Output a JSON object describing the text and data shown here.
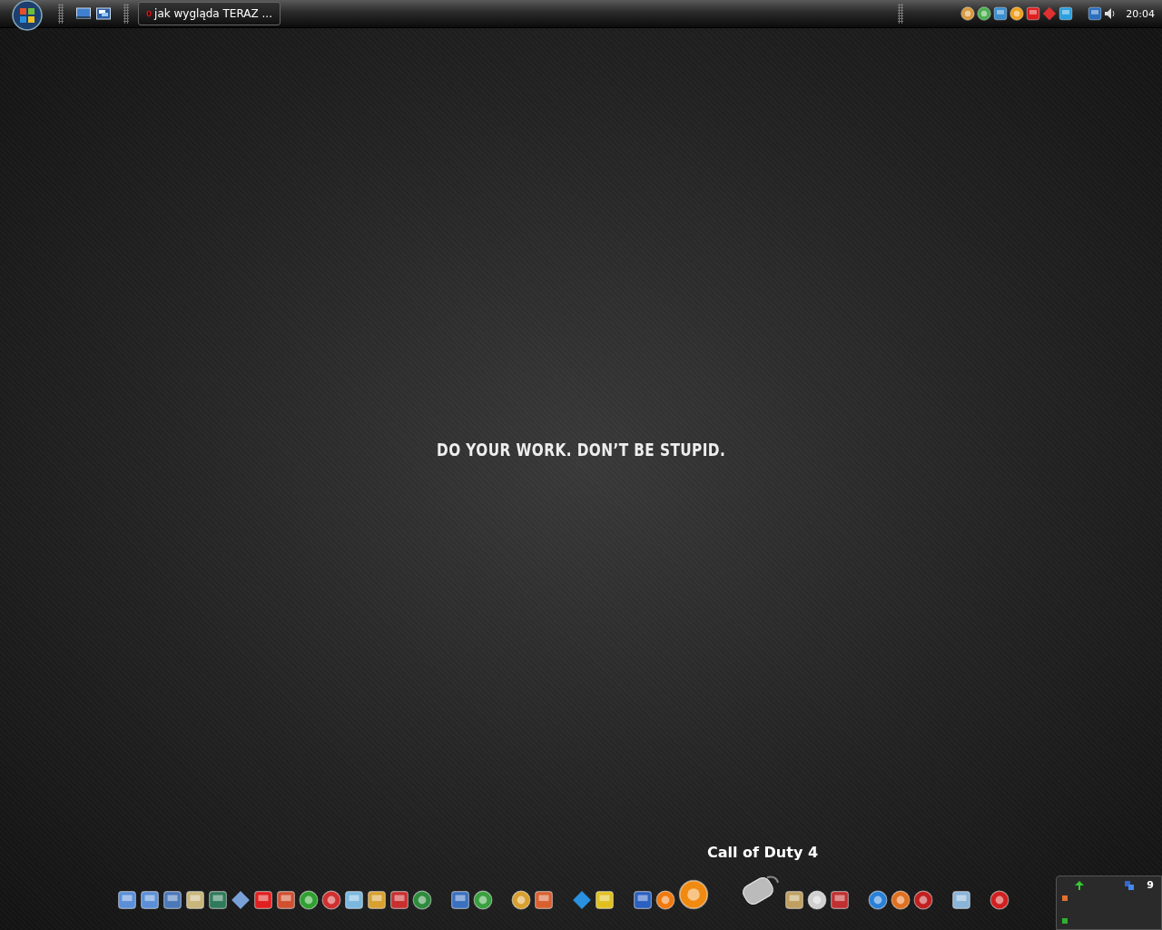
{
  "taskbar": {
    "window_buttons": [
      {
        "title": "jak wygląda TERAZ ..."
      }
    ],
    "clock": "20:04"
  },
  "wallpaper": {
    "slogan": "DO YOUR WORK. DON’T BE STUPID."
  },
  "dock": {
    "hover_label": "Call of Duty 4"
  },
  "gadget": {
    "count": "9"
  }
}
